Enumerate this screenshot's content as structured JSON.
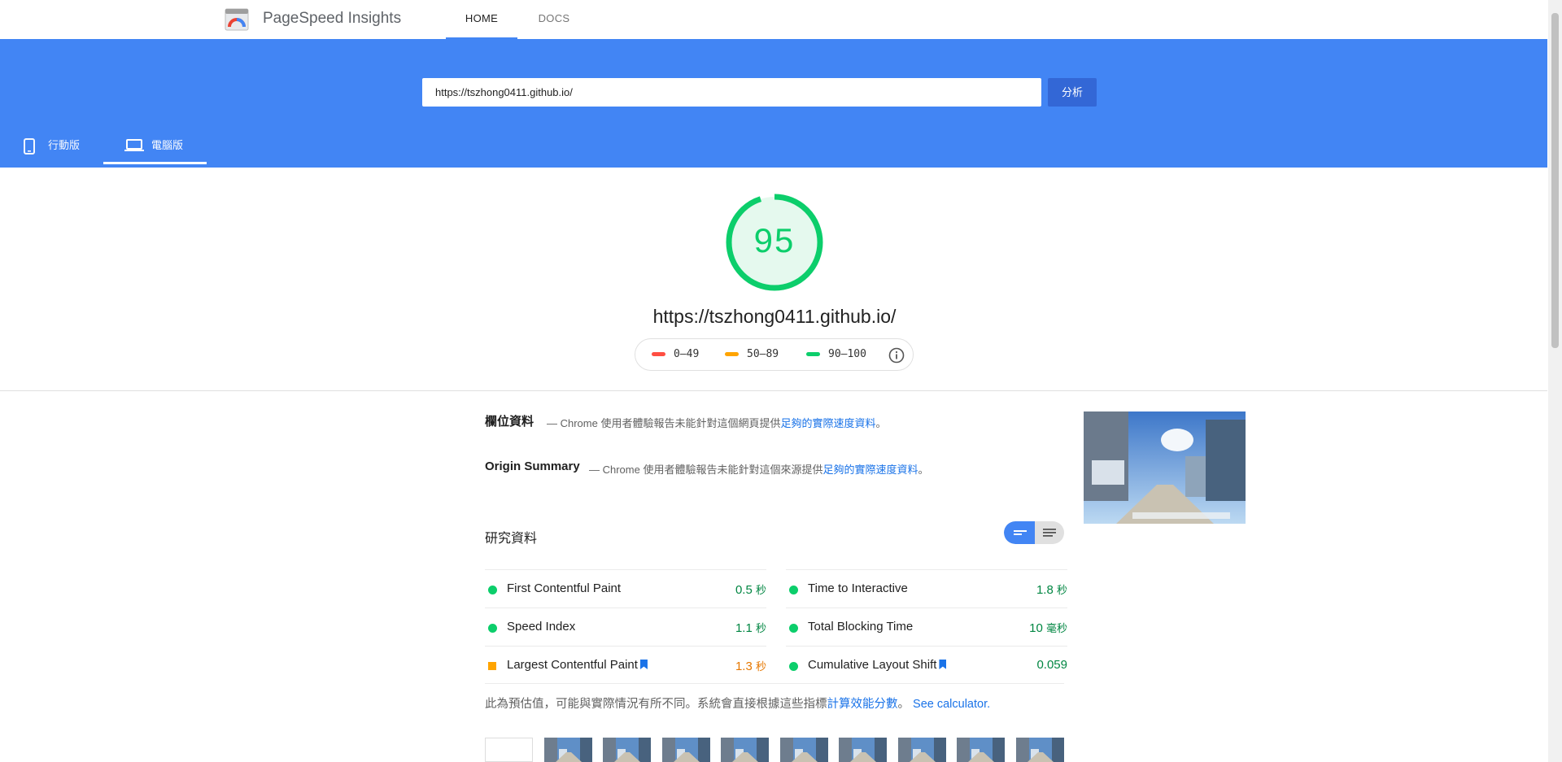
{
  "header": {
    "brand": "PageSpeed Insights",
    "nav": [
      {
        "label": "HOME"
      },
      {
        "label": "DOCS"
      }
    ]
  },
  "search": {
    "url_value": "https://tszhong0411.github.io/",
    "analyze_label": "分析"
  },
  "device_tabs": [
    {
      "label": "行動版"
    },
    {
      "label": "電腦版"
    }
  ],
  "summary": {
    "score": "95",
    "url": "https://tszhong0411.github.io/",
    "legend": [
      {
        "label": "0–49",
        "color": "#ff4e42"
      },
      {
        "label": "50–89",
        "color": "#ffa400"
      },
      {
        "label": "90–100",
        "color": "#0cce6b"
      }
    ]
  },
  "field": {
    "title": "欄位資料",
    "note_prefix": "— Chrome 使用者體驗報告未能針對這個網頁提供",
    "note_link": "足夠的實際速度資料",
    "note_suffix": "。"
  },
  "origin": {
    "title": "Origin Summary",
    "note_prefix": "— Chrome 使用者體驗報告未能針對這個來源提供",
    "note_link": "足夠的實際速度資料",
    "note_suffix": "。"
  },
  "lab": {
    "title": "研究資料",
    "metrics": [
      {
        "name": "First Contentful Paint",
        "value": "0.5",
        "unit": "秒",
        "status": "pass"
      },
      {
        "name": "Time to Interactive",
        "value": "1.8",
        "unit": "秒",
        "status": "pass"
      },
      {
        "name": "Speed Index",
        "value": "1.1",
        "unit": "秒",
        "status": "pass"
      },
      {
        "name": "Total Blocking Time",
        "value": "10",
        "unit": "毫秒",
        "status": "pass"
      },
      {
        "name": "Largest Contentful Paint",
        "value": "1.3",
        "unit": "秒",
        "status": "average"
      },
      {
        "name": "Cumulative Layout Shift",
        "value": "0.059",
        "unit": "",
        "status": "pass"
      }
    ],
    "footnote_prefix": "此為預估值，可能與實際情況有所不同。系統會直接根據這些指標",
    "footnote_link1": "計算效能分數",
    "footnote_mid": "。",
    "footnote_link2": "See calculator."
  },
  "colors": {
    "accent": "#4285f4",
    "pass": "#0cce6b",
    "average": "#ffa400",
    "fail": "#ff4e42"
  }
}
